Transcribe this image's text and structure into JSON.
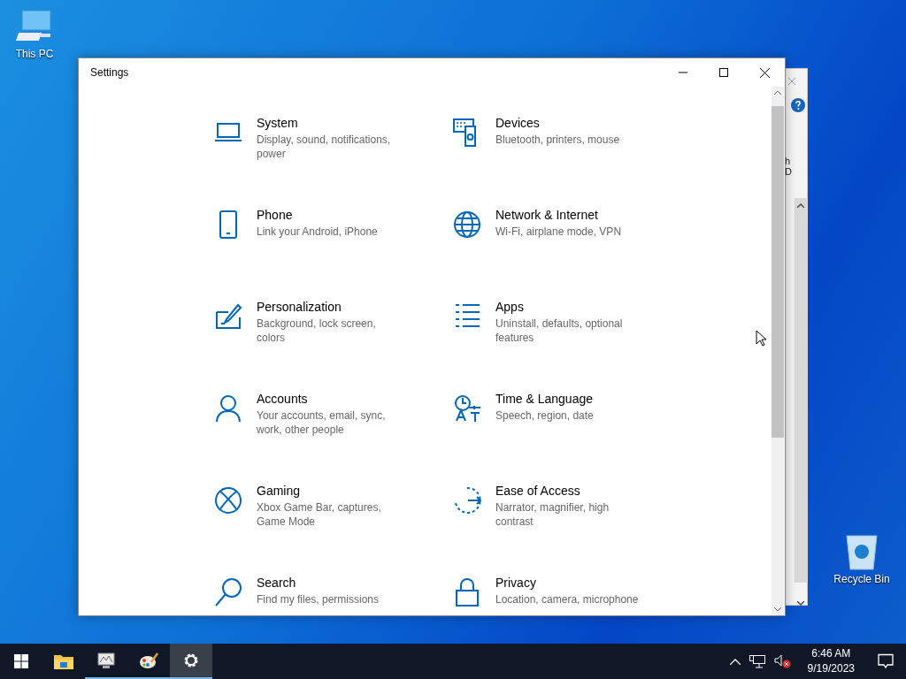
{
  "desktop_icons": [
    {
      "label": "This PC",
      "kind": "computer"
    },
    {
      "label": "Recycle Bin",
      "kind": "recycle"
    }
  ],
  "behind_window": {
    "fragments": [
      "h",
      "D"
    ]
  },
  "window": {
    "title": "Settings"
  },
  "categories": [
    {
      "title": "System",
      "subtitle": "Display, sound, notifications, power",
      "kind": "laptop"
    },
    {
      "title": "Devices",
      "subtitle": "Bluetooth, printers, mouse",
      "kind": "devices"
    },
    {
      "title": "Phone",
      "subtitle": "Link your Android, iPhone",
      "kind": "phone"
    },
    {
      "title": "Network & Internet",
      "subtitle": "Wi-Fi, airplane mode, VPN",
      "kind": "globe"
    },
    {
      "title": "Personalization",
      "subtitle": "Background, lock screen, colors",
      "kind": "brush"
    },
    {
      "title": "Apps",
      "subtitle": "Uninstall, defaults, optional features",
      "kind": "list"
    },
    {
      "title": "Accounts",
      "subtitle": "Your accounts, email, sync, work, other people",
      "kind": "person"
    },
    {
      "title": "Time & Language",
      "subtitle": "Speech, region, date",
      "kind": "language"
    },
    {
      "title": "Gaming",
      "subtitle": "Xbox Game Bar, captures, Game Mode",
      "kind": "xbox"
    },
    {
      "title": "Ease of Access",
      "subtitle": "Narrator, magnifier, high contrast",
      "kind": "ease"
    },
    {
      "title": "Search",
      "subtitle": "Find my files, permissions",
      "kind": "search"
    },
    {
      "title": "Privacy",
      "subtitle": "Location, camera, microphone",
      "kind": "lock"
    }
  ],
  "taskbar": {
    "apps": [
      {
        "kind": "explorer",
        "running": false,
        "active": false
      },
      {
        "kind": "monitor",
        "running": true,
        "active": false
      },
      {
        "kind": "paint",
        "running": true,
        "active": false
      },
      {
        "kind": "gear",
        "running": true,
        "active": true
      }
    ],
    "clock": {
      "time": "6:46 AM",
      "date": "9/19/2023"
    },
    "volume_muted": true
  }
}
